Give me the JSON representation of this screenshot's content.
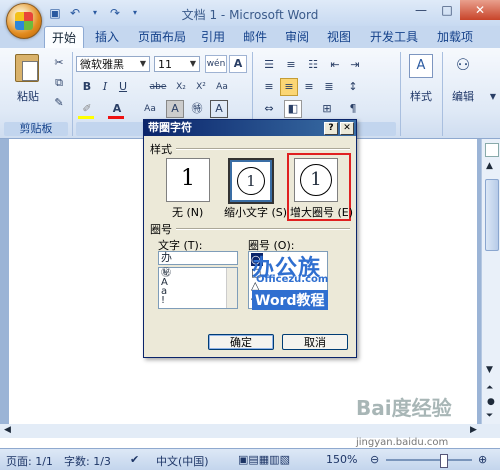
{
  "window": {
    "title": "文档 1 - Microsoft Word",
    "controls": {
      "minimize": "—",
      "maximize": "□",
      "close": "✕"
    }
  },
  "qat": {
    "save_icon": "save-icon",
    "undo_icon": "undo-icon",
    "redo_icon": "redo-icon"
  },
  "tabs": [
    {
      "label": "开始",
      "active": true
    },
    {
      "label": "插入"
    },
    {
      "label": "页面布局"
    },
    {
      "label": "引用"
    },
    {
      "label": "邮件"
    },
    {
      "label": "审阅"
    },
    {
      "label": "视图"
    },
    {
      "label": "开发工具"
    },
    {
      "label": "加载项"
    }
  ],
  "ribbon": {
    "clipboard": {
      "label": "剪贴板",
      "paste": "粘贴"
    },
    "font": {
      "name": "微软雅黑",
      "size": "11",
      "wen": "wén",
      "a_label": "A",
      "bold": "B",
      "italic": "I",
      "underline": "U",
      "strike": "abe",
      "sub": "X₂",
      "sup": "X²",
      "aa": "Aa",
      "a_red": "A",
      "char_border": "A"
    },
    "styles": {
      "label": "样式"
    },
    "editing": {
      "label": "编辑"
    }
  },
  "dialog": {
    "title": "带圈字符",
    "help": "?",
    "close": "✕",
    "style_group": "样式",
    "styles": [
      {
        "label": "无 (N)",
        "glyph": "1"
      },
      {
        "label": "缩小文字 (S)",
        "glyph": "1"
      },
      {
        "label": "增大圈号 (E)",
        "glyph": "1"
      }
    ],
    "enclosure_group": "圈号",
    "text_label": "文字 (T):",
    "text_value": "办",
    "text_list": [
      "㊙",
      "A",
      "a",
      "!"
    ],
    "enclosure_label": "圈号 (O):",
    "enclosure_list": [
      "○",
      "□",
      "△",
      "◇"
    ],
    "ok": "确定",
    "cancel": "取消"
  },
  "status": {
    "page": "页面: 1/1",
    "words": "字数: 1/3",
    "lang": "中文(中国)",
    "zoom": "150%"
  },
  "watermarks": {
    "bangong": "办公族",
    "site": "Officezu.com",
    "wordjc": "Word教程",
    "baidu": "Bai度经验",
    "baidu_url": "jingyan.baidu.com"
  }
}
